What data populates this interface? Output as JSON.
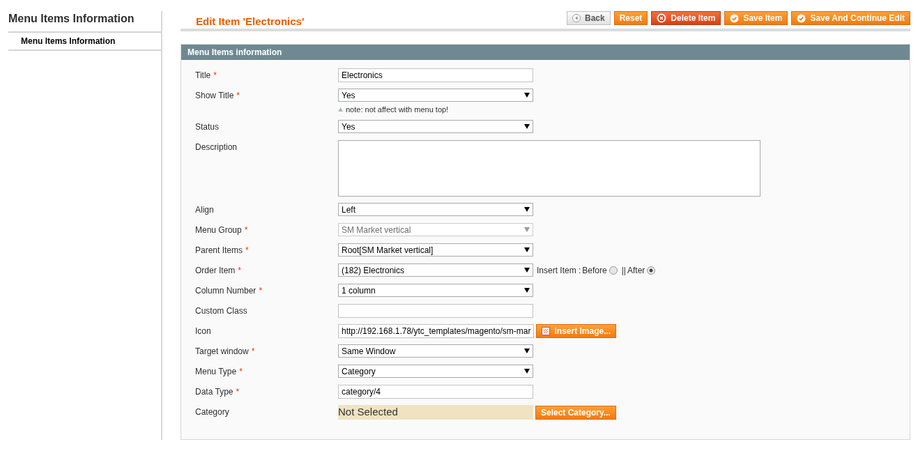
{
  "sidebar": {
    "title": "Menu Items Information",
    "items": [
      {
        "label": "Menu Items Information",
        "selected": true
      }
    ]
  },
  "header": {
    "title": "Edit Item 'Electronics'",
    "buttons": [
      {
        "label": "Back",
        "kind": "back"
      },
      {
        "label": "Reset",
        "kind": "plain"
      },
      {
        "label": "Delete Item",
        "kind": "delete"
      },
      {
        "label": "Save Item",
        "kind": "save"
      },
      {
        "label": "Save And Continue Edit",
        "kind": "save"
      }
    ]
  },
  "panel": {
    "title": "Menu Items information",
    "fields": [
      {
        "label": "Title",
        "required_mark": "*",
        "kind": "text",
        "value": "Electronics"
      },
      {
        "label": "Show Title",
        "required_mark": "*",
        "kind": "select",
        "value": "Yes",
        "disabled": false,
        "note": "note: not affect with menu top!"
      },
      {
        "label": "Status",
        "kind": "select",
        "value": "Yes",
        "disabled": false
      },
      {
        "label": "Description",
        "kind": "textarea"
      },
      {
        "label": "Align",
        "kind": "select",
        "value": "Left",
        "disabled": false
      },
      {
        "label": "Menu Group",
        "required_mark": "*",
        "kind": "select",
        "value": "SM Market vertical",
        "disabled": true
      },
      {
        "label": "Parent Items",
        "required_mark": "*",
        "kind": "select",
        "value": "Root[SM Market vertical]",
        "disabled": false
      },
      {
        "label": "Order Item",
        "required_mark": "*",
        "kind": "select",
        "value": "(182) Electronics",
        "disabled": false,
        "insert": {
          "label": "Insert Item :",
          "separator": "||",
          "options": [
            {
              "label": "Before",
              "selected": false
            },
            {
              "label": "After",
              "selected": true
            }
          ]
        }
      },
      {
        "label": "Column Number",
        "required_mark": "*",
        "kind": "select",
        "value": "1 column",
        "disabled": false
      },
      {
        "label": "Custom Class",
        "kind": "text"
      },
      {
        "label": "Icon",
        "kind": "text",
        "value": "http://192.168.1.78/ytc_templates/magento/sm-mar",
        "button": "Insert Image..."
      },
      {
        "label": "Target window",
        "required_mark": "*",
        "kind": "select",
        "value": "Same Window",
        "disabled": false
      },
      {
        "label": "Menu Type",
        "required_mark": "*",
        "kind": "select",
        "value": "Category",
        "disabled": false
      },
      {
        "label": "Data Type",
        "required_mark": "*",
        "kind": "text",
        "value": "category/4"
      },
      {
        "label": "Category",
        "kind": "category",
        "value": "Not Selected",
        "button": "Select Category..."
      }
    ]
  }
}
